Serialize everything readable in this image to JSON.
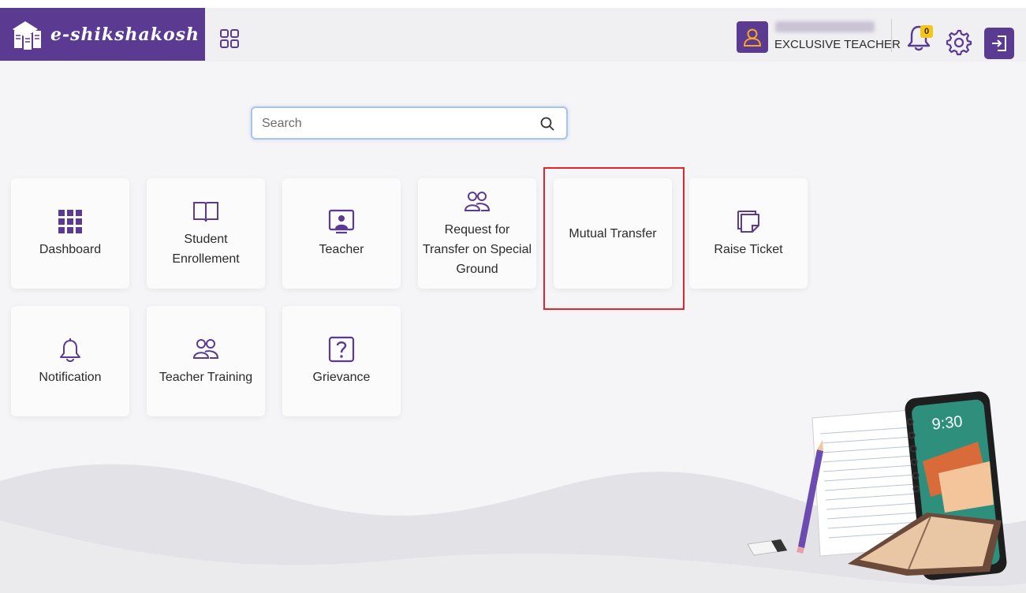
{
  "header": {
    "logo_text": "e-shikshakosh",
    "user_name": "REDACTED NAME",
    "user_role": "EXCLUSIVE TEACHER",
    "notification_count": "0"
  },
  "search": {
    "placeholder": "Search"
  },
  "tiles": [
    {
      "label": "Dashboard",
      "icon": "grid-icon"
    },
    {
      "label": "Student Enrollement",
      "icon": "book-icon"
    },
    {
      "label": "Teacher",
      "icon": "teacher-icon"
    },
    {
      "label": "Request for Transfer on Special Ground",
      "icon": "users-icon"
    },
    {
      "label": "Mutual Transfer",
      "icon": ""
    },
    {
      "label": "Raise Ticket",
      "icon": "ticket-icon"
    },
    {
      "label": "Notification",
      "icon": "bell-icon"
    },
    {
      "label": "Teacher Training",
      "icon": "users-icon"
    },
    {
      "label": "Grievance",
      "icon": "question-icon"
    }
  ],
  "illustration": {
    "phone_time": "9:30"
  },
  "colors": {
    "brand": "#5b3a92",
    "highlight": "#e0262c",
    "badge": "#f5c518"
  }
}
